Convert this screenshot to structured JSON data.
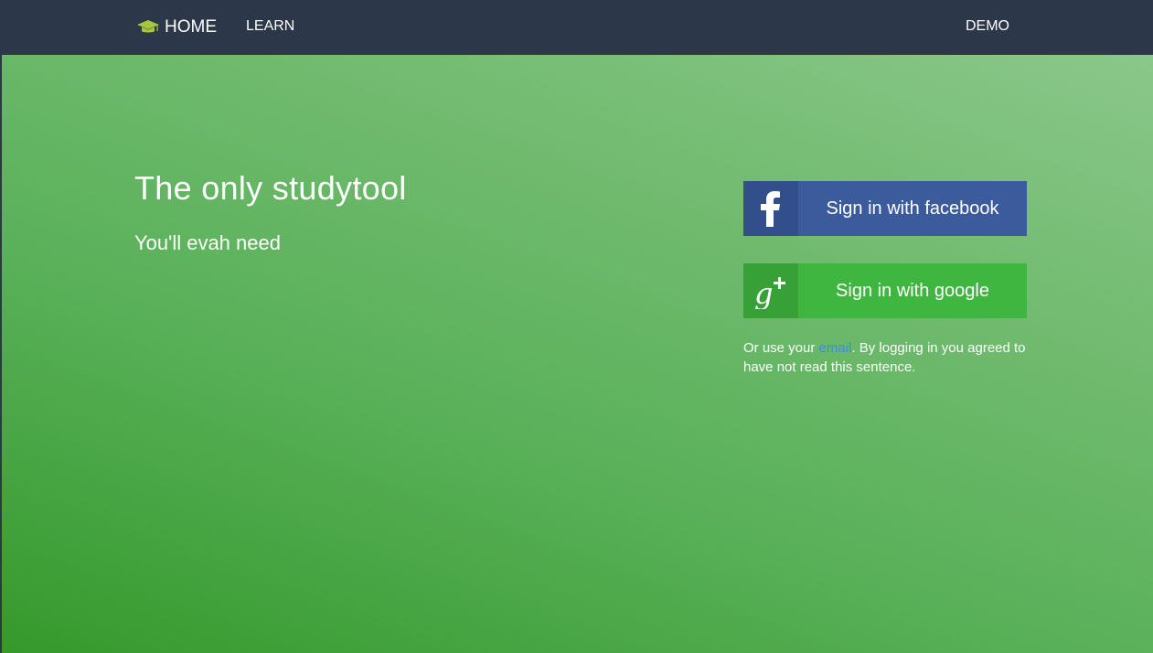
{
  "nav": {
    "home_label": "HOME",
    "learn_label": "LEARN",
    "demo_label": "DEMO",
    "home_icon": "graduation-cap-icon",
    "icon_color": "#a8c540"
  },
  "hero": {
    "headline": "The only studytool",
    "subheadline": "You'll evah need"
  },
  "auth": {
    "facebook": {
      "label": "Sign in with facebook",
      "icon": "facebook-icon",
      "color": "#3b5b9c"
    },
    "google": {
      "label": "Sign in with google",
      "icon": "google-plus-icon",
      "color": "#3fb63f"
    },
    "legal_prefix": "Or use your ",
    "email_link": "email",
    "legal_suffix": ". By logging in you agreed to have not read this sentence.",
    "link_color": "#3a8fd8"
  }
}
